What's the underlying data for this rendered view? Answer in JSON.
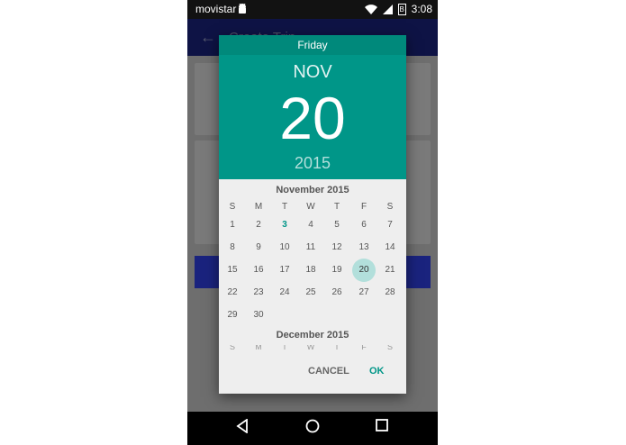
{
  "status_bar": {
    "carrier": "movistar",
    "time": "3:08",
    "battery": "B"
  },
  "app_bar": {
    "title": "Create Trip"
  },
  "dialog": {
    "day_of_week": "Friday",
    "month": "NOV",
    "date": "20",
    "year": "2015",
    "calendar_title": "November 2015",
    "next_calendar_title": "December 2015",
    "weekdays": [
      "S",
      "M",
      "T",
      "W",
      "T",
      "F",
      "S"
    ],
    "weeks": [
      [
        "1",
        "2",
        "3",
        "4",
        "5",
        "6",
        "7"
      ],
      [
        "8",
        "9",
        "10",
        "11",
        "12",
        "13",
        "14"
      ],
      [
        "15",
        "16",
        "17",
        "18",
        "19",
        "20",
        "21"
      ],
      [
        "22",
        "23",
        "24",
        "25",
        "26",
        "27",
        "28"
      ],
      [
        "29",
        "30",
        "",
        "",
        "",
        "",
        ""
      ]
    ],
    "today": "3",
    "selected": "20",
    "cancel_label": "CANCEL",
    "ok_label": "OK"
  },
  "colors": {
    "accent": "#009688",
    "header": "#009688",
    "appbar": "#1a237e"
  }
}
